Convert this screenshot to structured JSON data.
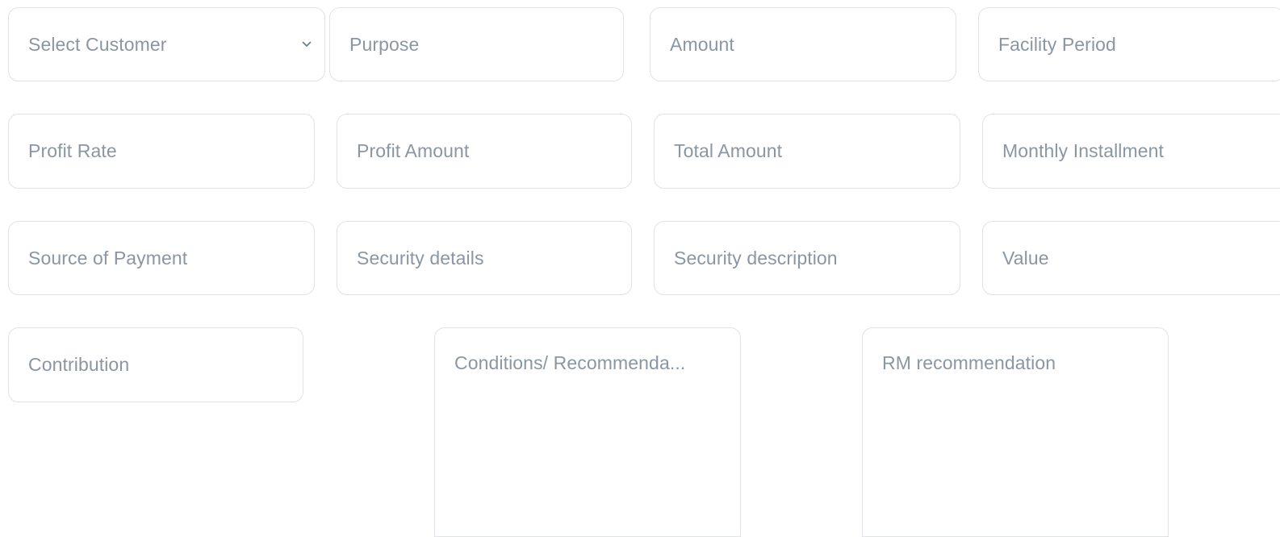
{
  "form": {
    "row1": {
      "customer_select": {
        "placeholder": "Select Customer",
        "icon": "chevron-down-icon"
      },
      "purpose": {
        "placeholder": "Purpose"
      },
      "amount": {
        "placeholder": "Amount"
      },
      "facility_period": {
        "placeholder": "Facility Period"
      }
    },
    "row2": {
      "profit_rate": {
        "placeholder": "Profit Rate"
      },
      "profit_amount": {
        "placeholder": "Profit Amount"
      },
      "total_amount": {
        "placeholder": "Total Amount"
      },
      "monthly_installment": {
        "placeholder": "Monthly Installment"
      }
    },
    "row3": {
      "source_of_payment": {
        "placeholder": "Source of Payment"
      },
      "security_details": {
        "placeholder": "Security details"
      },
      "security_description": {
        "placeholder": "Security description"
      },
      "value": {
        "placeholder": "Value"
      }
    },
    "row4": {
      "contribution": {
        "placeholder": "Contribution"
      },
      "conditions": {
        "placeholder": "Conditions/ Recommenda..."
      },
      "rm_recommendation": {
        "placeholder": "RM recommendation"
      }
    }
  },
  "colors": {
    "border": "#dfe3e8",
    "placeholder_text": "#8a96a3",
    "background": "#ffffff"
  }
}
